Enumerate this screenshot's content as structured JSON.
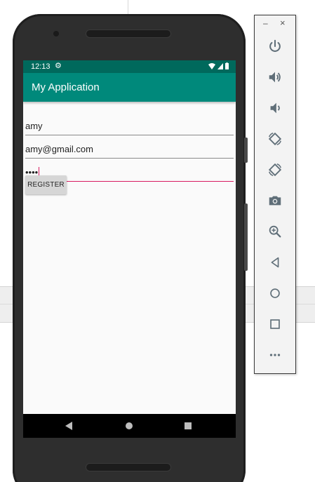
{
  "status_bar": {
    "time": "12:13"
  },
  "app_bar": {
    "title": "My Application"
  },
  "form": {
    "name_value": "amy",
    "email_value": "amy@gmail.com",
    "password_value": "••••",
    "register_label": "REGISTER"
  },
  "emulator_toolbar": {
    "minimize_label": "–",
    "close_label": "×",
    "buttons": [
      "power-icon",
      "volume-up-icon",
      "volume-down-icon",
      "rotate-left-icon",
      "rotate-right-icon",
      "camera-icon",
      "zoom-icon",
      "back-icon",
      "home-icon",
      "overview-icon",
      "more-icon"
    ]
  },
  "colors": {
    "status_bar": "#00695c",
    "app_bar": "#00897b",
    "accent": "#d81b60",
    "toolbar_icon": "#5f6e78"
  }
}
